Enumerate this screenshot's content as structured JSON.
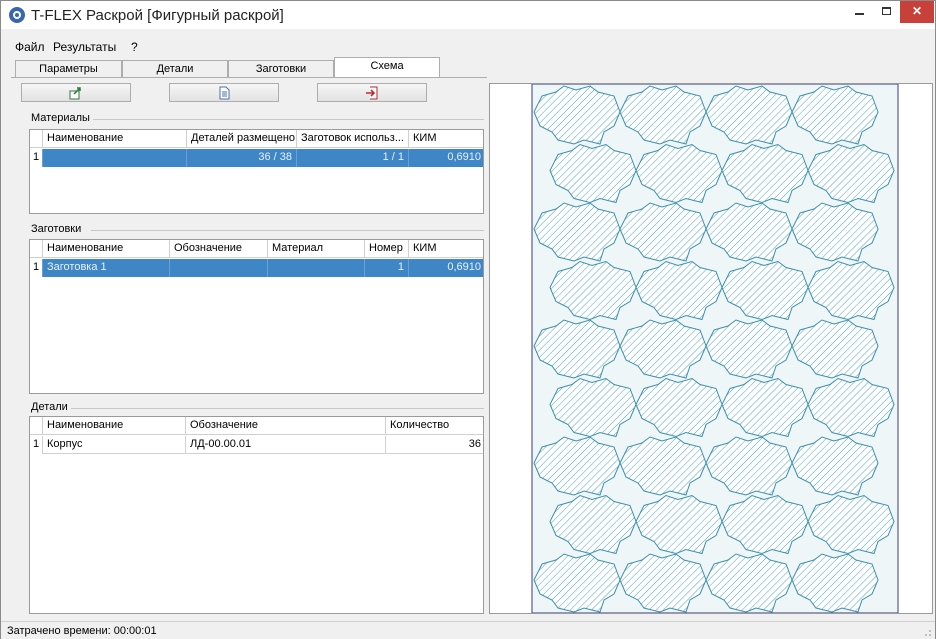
{
  "window": {
    "title": "T-FLEX Раскрой [Фигурный раскрой]",
    "min_icon": "minimize-icon",
    "max_icon": "maximize-icon",
    "close_icon": "close-icon",
    "close_glyph": "✕"
  },
  "menu": {
    "items": [
      "Файл",
      "Результаты",
      "?"
    ]
  },
  "tabs": {
    "items": [
      "Параметры",
      "Детали",
      "Заготовки",
      "Схема"
    ],
    "active": "Схема"
  },
  "toolbar": {
    "buttons": [
      "export-icon",
      "document-icon",
      "import-icon"
    ]
  },
  "materials": {
    "label": "Материалы",
    "columns": [
      "Наименование",
      "Деталей размещено",
      "Заготовок использ...",
      "КИМ"
    ],
    "rows": [
      {
        "index": "1",
        "name": "",
        "placed": "36 / 38",
        "blanks_used": "1 / 1",
        "kim": "0,6910"
      }
    ]
  },
  "blanks": {
    "label": "Заготовки",
    "columns": [
      "Наименование",
      "Обозначение",
      "Материал",
      "Номер",
      "КИМ"
    ],
    "rows": [
      {
        "index": "1",
        "name": "Заготовка 1",
        "designation": "",
        "material": "",
        "number": "1",
        "kim": "0,6910"
      }
    ]
  },
  "parts": {
    "label": "Детали",
    "columns": [
      "Наименование",
      "Обозначение",
      "Количество"
    ],
    "rows": [
      {
        "index": "1",
        "name": "Корпус",
        "designation": "ЛД-00.00.01",
        "quantity": "36"
      }
    ]
  },
  "preview": {
    "parts_shown": 36,
    "part_fill": "#d8eef2",
    "part_stroke": "#3a8fb0",
    "sheet_color": "#eef6f7",
    "sheet_border": "#3a3a8a"
  },
  "status": {
    "text": "Затрачено времени: 00:00:01"
  },
  "colors": {
    "selection": "#3f86c7",
    "close_button": "#c7403a"
  }
}
